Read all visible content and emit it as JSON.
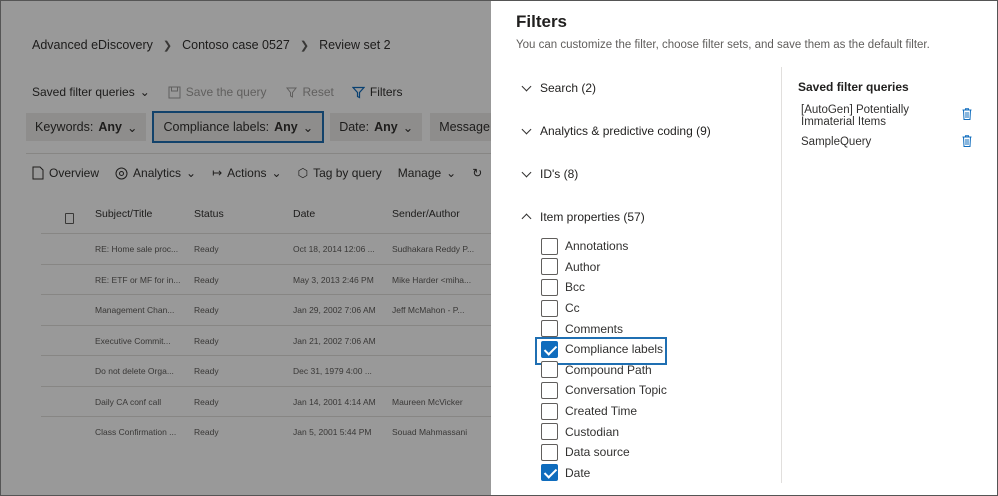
{
  "breadcrumb": [
    "Advanced eDiscovery",
    "Contoso case 0527",
    "Review set 2"
  ],
  "cmdbar": {
    "saved_queries": "Saved filter queries",
    "save_query": "Save the query",
    "reset": "Reset",
    "filters": "Filters"
  },
  "filter_pills": [
    {
      "label": "Keywords:",
      "value": "Any"
    },
    {
      "label": "Compliance labels:",
      "value": "Any"
    },
    {
      "label": "Date:",
      "value": "Any"
    },
    {
      "label": "Message kind",
      "value": ""
    }
  ],
  "actions": {
    "overview": "Overview",
    "analytics": "Analytics",
    "actions": "Actions",
    "tag": "Tag by query",
    "manage": "Manage"
  },
  "table": {
    "columns": [
      "Subject/Title",
      "Status",
      "Date",
      "Sender/Author"
    ],
    "rows": [
      [
        "RE: Home sale proc...",
        "Ready",
        "Oct 18, 2014 12:06 ...",
        "Sudhakara Reddy P..."
      ],
      [
        "RE: ETF or MF for in...",
        "Ready",
        "May 3, 2013 2:46 PM",
        "Mike Harder <miha..."
      ],
      [
        "Management Chan...",
        "Ready",
        "Jan 29, 2002 7:06 AM",
        "Jeff McMahon - P..."
      ],
      [
        "Executive Commit...",
        "Ready",
        "Jan 21, 2002 7:06 AM",
        ""
      ],
      [
        "Do not delete Orga...",
        "Ready",
        "Dec 31, 1979 4:00 ...",
        ""
      ],
      [
        "Daily CA conf call",
        "Ready",
        "Jan 14, 2001 4:14 AM",
        "Maureen McVicker"
      ],
      [
        "Class Confirmation ...",
        "Ready",
        "Jan 5, 2001 5:44 PM",
        "Souad Mahmassani"
      ]
    ]
  },
  "panel": {
    "title": "Filters",
    "subtitle": "You can customize the filter, choose filter sets, and save them as the default filter.",
    "sections": [
      {
        "label": "Search (2)",
        "expanded": false
      },
      {
        "label": "Analytics & predictive coding (9)",
        "expanded": false
      },
      {
        "label": "ID's (8)",
        "expanded": false
      },
      {
        "label": "Item properties (57)",
        "expanded": true
      }
    ],
    "item_properties": [
      {
        "label": "Annotations",
        "checked": false
      },
      {
        "label": "Author",
        "checked": false
      },
      {
        "label": "Bcc",
        "checked": false
      },
      {
        "label": "Cc",
        "checked": false
      },
      {
        "label": "Comments",
        "checked": false
      },
      {
        "label": "Compliance labels",
        "checked": true
      },
      {
        "label": "Compound Path",
        "checked": false
      },
      {
        "label": "Conversation Topic",
        "checked": false
      },
      {
        "label": "Created Time",
        "checked": false
      },
      {
        "label": "Custodian",
        "checked": false
      },
      {
        "label": "Data source",
        "checked": false
      },
      {
        "label": "Date",
        "checked": true
      }
    ],
    "saved_title": "Saved filter queries",
    "saved_queries": [
      {
        "line1": "[AutoGen] Potentially",
        "line2": "Immaterial Items"
      },
      {
        "line1": "SampleQuery",
        "line2": ""
      }
    ]
  },
  "colors": {
    "accent": "#0f6cbd",
    "highlight": "#1f6fb2",
    "overlay": "rgba(0,0,0,0.4)"
  }
}
